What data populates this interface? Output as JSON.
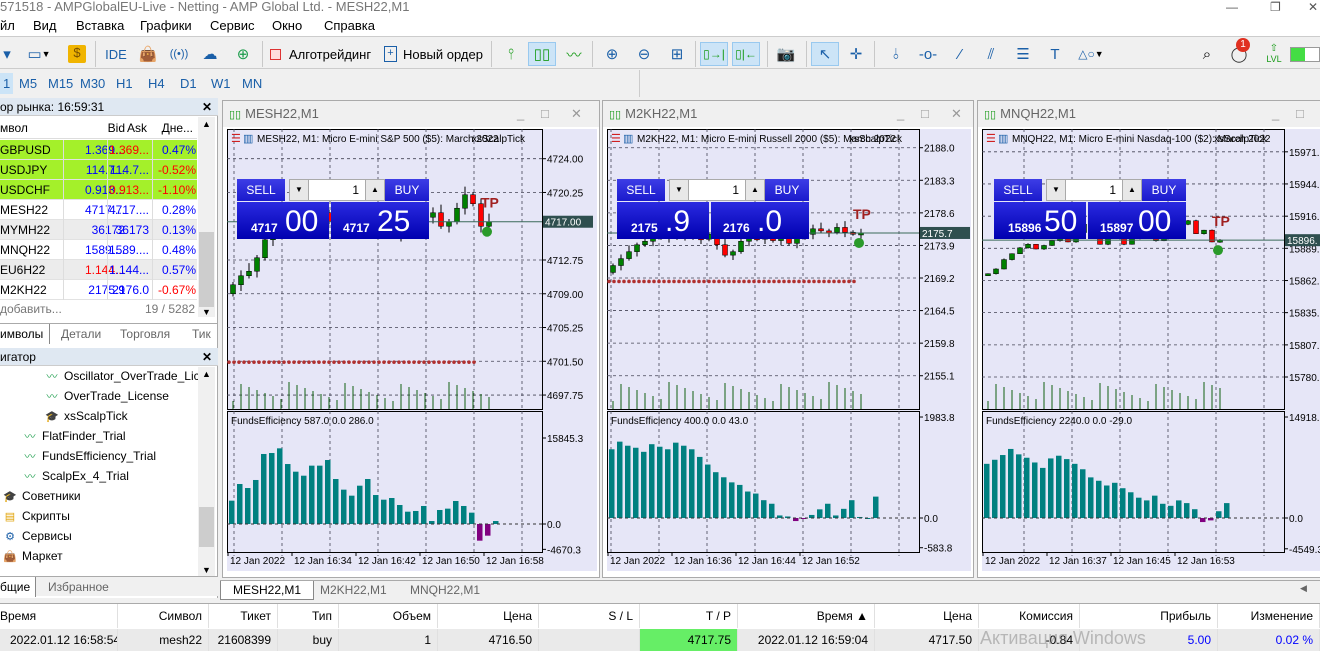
{
  "window": {
    "title": "571518 - AMPGlobalEU-Live - Netting - AMP Global Ltd. - MESH22,M1"
  },
  "menu": [
    "йл",
    "Вид",
    "Вставка",
    "Графики",
    "Сервис",
    "Окно",
    "Справка"
  ],
  "toolbar": {
    "ide": "IDE",
    "algo": "Алготрейдинг",
    "new_order": "Новый ордер",
    "notif_count": "1",
    "lvl": "LVL"
  },
  "timeframes": {
    "items": [
      "1",
      "M5",
      "M15",
      "M30",
      "H1",
      "H4",
      "D1",
      "W1",
      "MN"
    ],
    "selected": "1"
  },
  "market_watch": {
    "title": "ор рынка: 16:59:31",
    "headers": {
      "symbol": "мвол",
      "bid": "Bid",
      "ask": "Ask",
      "change": "Дне..."
    },
    "rows": [
      {
        "symbol": "GBPUSD",
        "bid": "1.369...",
        "ask": "1.369...",
        "change": "0.47%",
        "bid_color": "#0000ff",
        "ask_color": "#ff0000",
        "change_color": "#0000ff",
        "bg": "#a4f02a"
      },
      {
        "symbol": "USDJPY",
        "bid": "114.7...",
        "ask": "114.7...",
        "change": "-0.52%",
        "bid_color": "#0000ff",
        "ask_color": "#0000ff",
        "change_color": "#ff0000",
        "bg": "#a4f02a"
      },
      {
        "symbol": "USDCHF",
        "bid": "0.913...",
        "ask": "0.913...",
        "change": "-1.10%",
        "bid_color": "#0000ff",
        "ask_color": "#ff0000",
        "change_color": "#ff0000",
        "bg": "#a4f02a"
      },
      {
        "symbol": "MESH22",
        "bid": "4717....",
        "ask": "4717....",
        "change": "0.28%",
        "bid_color": "#0000ff",
        "ask_color": "#0000ff",
        "change_color": "#0000ff",
        "bg": "#ffffff"
      },
      {
        "symbol": "MYMH22",
        "bid": "36172",
        "ask": "36173",
        "change": "0.13%",
        "bid_color": "#0000ff",
        "ask_color": "#0000ff",
        "change_color": "#0000ff",
        "bg": "#ececec"
      },
      {
        "symbol": "MNQH22",
        "bid": "1589....",
        "ask": "1589....",
        "change": "0.48%",
        "bid_color": "#0000ff",
        "ask_color": "#0000ff",
        "change_color": "#0000ff",
        "bg": "#ffffff"
      },
      {
        "symbol": "EU6H22",
        "bid": "1.144...",
        "ask": "1.144...",
        "change": "0.57%",
        "bid_color": "#ff0000",
        "ask_color": "#0000ff",
        "change_color": "#0000ff",
        "bg": "#ececec"
      },
      {
        "symbol": "M2KH22",
        "bid": "2175.9",
        "ask": "2176.0",
        "change": "-0.67%",
        "bid_color": "#0000ff",
        "ask_color": "#0000ff",
        "change_color": "#ff0000",
        "bg": "#ffffff"
      }
    ],
    "add": "добавить...",
    "count": "19 / 5282",
    "tabs": [
      "имволы",
      "Детали",
      "Торговля",
      "Тик"
    ]
  },
  "navigator": {
    "title": "игатор",
    "items": [
      {
        "label": "Oscillator_OverTrade_Lic",
        "icon": "indicator-icon",
        "level": 2
      },
      {
        "label": "OverTrade_License",
        "icon": "indicator-icon",
        "level": 2
      },
      {
        "label": "xsScalpTick",
        "icon": "expert-icon",
        "level": 2
      },
      {
        "label": "FlatFinder_Trial",
        "icon": "indicator-icon",
        "level": 1
      },
      {
        "label": "FundsEfficiency_Trial",
        "icon": "indicator-icon",
        "level": 1
      },
      {
        "label": "ScalpEx_4_Trial",
        "icon": "indicator-icon",
        "level": 1
      },
      {
        "label": "Советники",
        "icon": "expert-icon",
        "level": 0
      },
      {
        "label": "Скрипты",
        "icon": "script-icon",
        "level": 0
      },
      {
        "label": "Сервисы",
        "icon": "service-icon",
        "level": 0
      },
      {
        "label": "Маркет",
        "icon": "market-icon",
        "level": 0
      }
    ],
    "tabs": [
      "бщие",
      "Избранное"
    ]
  },
  "charts": [
    {
      "title": "MESH22,M1",
      "header": "MESH22, M1:  Micro E-mini S&P 500 ($5): March 2022",
      "ea": "xsScalpTick",
      "qty": "1",
      "sell": "SELL",
      "buy": "BUY",
      "sell_small": "4717",
      "sell_big": "00",
      "buy_small": "4717",
      "buy_big": "25",
      "price_range": [
        4696.2,
        4727.3
      ],
      "price_labels": [
        {
          "text": "4724.00",
          "value": 4724
        },
        {
          "text": "4720.25",
          "value": 4720.25
        },
        {
          "text": "4712.75",
          "value": 4712.75
        },
        {
          "text": "4709.00",
          "value": 4709
        },
        {
          "text": "4705.25",
          "value": 4705.25
        },
        {
          "text": "4701.50",
          "value": 4701.5
        },
        {
          "text": "4697.75",
          "value": 4697.75
        }
      ],
      "current_price": {
        "text": "4717.00",
        "value": 4717
      },
      "tp_level": 4701.4,
      "tp_label": "TP",
      "closes": [
        4710,
        4711,
        4711.5,
        4713,
        4715,
        4716.5,
        4717,
        4718,
        4716.5,
        4717,
        4717.5,
        4718,
        4717,
        4716,
        4717.5,
        4718,
        4716,
        4717,
        4716.5,
        4717.5,
        4716,
        4715.5,
        4717,
        4716,
        4717.5,
        4718,
        4716.5,
        4717,
        4718.5,
        4720,
        4719,
        4716.5,
        4717
      ],
      "indicator": {
        "label": "FundsEfficiency 587.0 0.0 286.0",
        "range": [
          -5158,
          20820
        ],
        "labels": [
          {
            "text": "15845.3",
            "value": 15845.3
          },
          {
            "text": "0.0",
            "value": 0
          },
          {
            "text": "-4670.3",
            "value": -4670.3
          }
        ],
        "values": [
          4300,
          7370,
          6630,
          8110,
          12900,
          13080,
          13940,
          11050,
          9640,
          8900,
          10750,
          10750,
          11790,
          8290,
          6330,
          5220,
          7060,
          8290,
          5340,
          4480,
          4790,
          3500,
          2270,
          2400,
          3320,
          550,
          2580,
          2830,
          4240,
          3320,
          2090,
          -3070,
          -2150,
          550
        ]
      },
      "time_labels": [
        "12 Jan 2022",
        "12 Jan 16:34",
        "12 Jan 16:42",
        "12 Jan 16:50",
        "12 Jan 16:58"
      ]
    },
    {
      "title": "M2KH22,M1",
      "header": "M2KH22, M1:  Micro E-mini Russell 2000 ($5): March 2022",
      "ea": "xsScalpTick",
      "qty": "1",
      "sell": "SELL",
      "buy": "BUY",
      "sell_small": "2175",
      "sell_big": ".9",
      "buy_small": "2176",
      "buy_big": ".0",
      "price_range": [
        2150.3,
        2190.7
      ],
      "price_labels": [
        {
          "text": "2188.0",
          "value": 2188
        },
        {
          "text": "2183.3",
          "value": 2183.3
        },
        {
          "text": "2178.6",
          "value": 2178.6
        },
        {
          "text": "2173.9",
          "value": 2173.9
        },
        {
          "text": "2169.2",
          "value": 2169.2
        },
        {
          "text": "2164.5",
          "value": 2164.5
        },
        {
          "text": "2159.8",
          "value": 2159.8
        },
        {
          "text": "2155.1",
          "value": 2155.1
        }
      ],
      "current_price": {
        "text": "2175.7",
        "value": 2175.7
      },
      "tp_level": 2168.7,
      "tp_label": "TP",
      "closes": [
        2171,
        2172,
        2173,
        2174,
        2174.5,
        2175,
        2175.5,
        2175,
        2175.3,
        2175.6,
        2175,
        2174.8,
        2175.5,
        2174,
        2172.5,
        2173,
        2174.5,
        2175,
        2174.8,
        2175.2,
        2174.6,
        2175,
        2174.2,
        2175,
        2175.5,
        2176.3,
        2176,
        2175.8,
        2176.5,
        2175.8,
        2175.6,
        2175.7
      ],
      "indicator": {
        "label": "FundsEfficiency 400.0 0.0 43.0",
        "range": [
          -668,
          2102
        ],
        "labels": [
          {
            "text": "1983.8",
            "value": 1983.8
          },
          {
            "text": "0.0",
            "value": 0
          },
          {
            "text": "-583.8",
            "value": -583.8
          }
        ],
        "values": [
          1350,
          1500,
          1420,
          1380,
          1300,
          1450,
          1400,
          1350,
          1480,
          1420,
          1350,
          1200,
          1050,
          900,
          800,
          700,
          650,
          520,
          480,
          350,
          280,
          50,
          30,
          -60,
          -20,
          60,
          170,
          280,
          50,
          180,
          350,
          20,
          0,
          420
        ]
      },
      "time_labels": [
        "12 Jan 2022",
        "12 Jan 16:36",
        "12 Jan 16:44",
        "12 Jan 16:52"
      ]
    },
    {
      "title": "MNQH22,M1",
      "header": "MNQH22, M1:  Micro E-mini Nasdaq-100 ($2): March 2022",
      "ea": "xsScalpTick",
      "qty": "1",
      "sell": "SELL",
      "buy": "BUY",
      "sell_small": "15896",
      "sell_big": "50",
      "buy_small": "15897",
      "buy_big": "00",
      "price_range": [
        15753,
        15991
      ],
      "price_labels": [
        {
          "text": "15971.",
          "value": 15971.6
        },
        {
          "text": "15944.",
          "value": 15944.3
        },
        {
          "text": "15916.",
          "value": 15916.9
        },
        {
          "text": "15889.",
          "value": 15889.6
        },
        {
          "text": "15862.",
          "value": 15862.2
        },
        {
          "text": "15835.",
          "value": 15834.9
        },
        {
          "text": "15807.",
          "value": 15807.5
        },
        {
          "text": "15780.",
          "value": 15780.2
        }
      ],
      "current_price": {
        "text": "15896.",
        "value": 15896.5
      },
      "tp_level": null,
      "tp_label": "TP",
      "closes": [
        15868,
        15872,
        15880,
        15885,
        15890,
        15893,
        15889,
        15892,
        15896,
        15900,
        15895,
        15903,
        15910,
        15915,
        15893,
        15905,
        15900,
        15893,
        15898,
        15901,
        15905,
        15896,
        15900,
        15904,
        15910,
        15913,
        15902,
        15905,
        15895,
        15896.5
      ],
      "indicator": {
        "label": "FundsEfficiency 2240.0 0.0 -29.0",
        "range": [
          -5022,
          15804
        ],
        "labels": [
          {
            "text": "14918.0",
            "value": 14918
          },
          {
            "text": "0.0",
            "value": 0
          },
          {
            "text": "-4549.3",
            "value": -4549.3
          }
        ],
        "values": [
          8000,
          8600,
          9300,
          10200,
          9400,
          8900,
          8200,
          7400,
          8800,
          9200,
          8700,
          8000,
          7200,
          6000,
          5500,
          4800,
          5200,
          4400,
          3800,
          3000,
          2600,
          3300,
          2100,
          1800,
          2600,
          2200,
          1300,
          -600,
          -350,
          1000,
          2200
        ]
      },
      "time_labels": [
        "12 Jan 2022",
        "12 Jan 16:37",
        "12 Jan 16:45",
        "12 Jan 16:53"
      ]
    }
  ],
  "chart_tabs": [
    "MESH22,M1",
    "M2KH22,M1",
    "MNQH22,M1"
  ],
  "positions": {
    "headers": [
      "Время",
      "Символ",
      "Тикет",
      "Тип",
      "Объем",
      "Цена",
      "S / L",
      "T / P",
      "Время ▲",
      "Цена",
      "Комиссия",
      "Прибыль",
      "Изменение"
    ],
    "rows": [
      [
        "2022.01.12 16:58:54",
        "mesh22",
        "21608399",
        "buy",
        "1",
        "4716.50",
        "",
        "4717.75",
        "2022.01.12 16:59:04",
        "4717.50",
        "-0.84",
        "5.00",
        "0.02 %"
      ]
    ]
  },
  "watermark": "Активация Windows",
  "colors": {
    "bull": "#008000",
    "bear": "#ff0000",
    "hist_pos": "#008080",
    "hist_neg": "#800080",
    "chart_bg": "#e6e6f7",
    "panel_blue": "#1a1acc",
    "tp_green": "#66ee66"
  }
}
